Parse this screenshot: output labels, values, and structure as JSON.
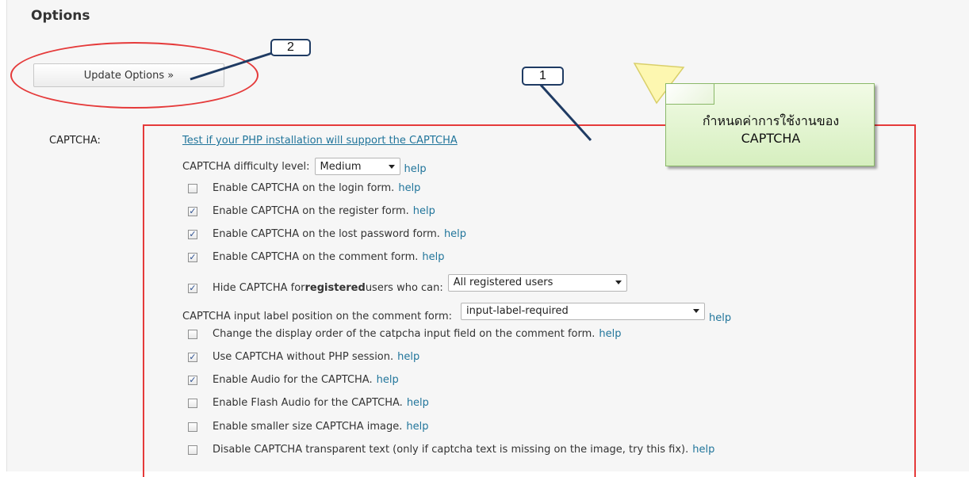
{
  "header": {
    "title": "Options"
  },
  "update_button": {
    "label": "Update Options »"
  },
  "captcha": {
    "row_label": "CAPTCHA:",
    "test_link": "Test if your PHP installation will support the CAPTCHA",
    "difficulty": {
      "label": "CAPTCHA difficulty level:",
      "value": "Medium",
      "help": "help"
    },
    "options": [
      {
        "checked": false,
        "label": "Enable CAPTCHA on the login form.",
        "help": "help"
      },
      {
        "checked": true,
        "label": "Enable CAPTCHA on the register form.",
        "help": "help"
      },
      {
        "checked": true,
        "label": "Enable CAPTCHA on the lost password form.",
        "help": "help"
      },
      {
        "checked": true,
        "label": "Enable CAPTCHA on the comment form.",
        "help": "help"
      }
    ],
    "hide_for": {
      "checked": true,
      "label_pre": "Hide CAPTCHA for ",
      "label_bold": "registered",
      "label_post": " users who can:",
      "value": "All registered users"
    },
    "label_position": {
      "label": "CAPTCHA input label position on the comment form:",
      "value": "input-label-required",
      "help": "help"
    },
    "more_options": [
      {
        "checked": false,
        "label": "Change the display order of the catpcha input field on the comment form.",
        "help": "help"
      },
      {
        "checked": true,
        "label": "Use CAPTCHA without PHP session.",
        "help": "help"
      },
      {
        "checked": true,
        "label": "Enable Audio for the CAPTCHA.",
        "help": "help"
      },
      {
        "checked": false,
        "label": "Enable Flash Audio for the CAPTCHA.",
        "help": "help"
      },
      {
        "checked": false,
        "label": "Enable smaller size CAPTCHA image.",
        "help": "help"
      },
      {
        "checked": false,
        "label": "Disable CAPTCHA transparent text (only if captcha text is missing on the image, try this fix).",
        "help": "help"
      }
    ]
  },
  "annotations": {
    "badge_1": "1",
    "badge_2": "2",
    "callout_line1": "กำหนดค่าการใช้งานของ",
    "callout_line2": "CAPTCHA",
    "highlight_color": "#e53a3a",
    "pointer_color": "#1f3b63"
  }
}
